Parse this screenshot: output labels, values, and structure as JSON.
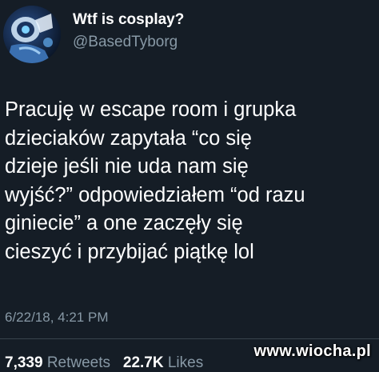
{
  "tweet": {
    "author": {
      "display_name": "Wtf is cosplay?",
      "handle": "@BasedTyborg",
      "avatar_icon": "robot-avatar-icon"
    },
    "text_lines": [
      "Pracuję w escape room i grupka",
      "dzieciaków zapytała “co się",
      "dzieje jeśli nie uda nam się",
      "wyjść?” odpowiedziałem “od razu",
      "giniecie” a one zaczęły się",
      "cieszyć i przybijać piątkę lol"
    ],
    "timestamp": "6/22/18, 4:21 PM",
    "stats": {
      "retweets_count": "7,339",
      "retweets_label": "Retweets",
      "likes_count": "22.7K",
      "likes_label": "Likes"
    }
  },
  "watermark": "www.wiocha.pl",
  "colors": {
    "background": "#151d26",
    "primary_text": "#ffffff",
    "secondary_text": "#8899a6",
    "divider": "#38444d"
  }
}
